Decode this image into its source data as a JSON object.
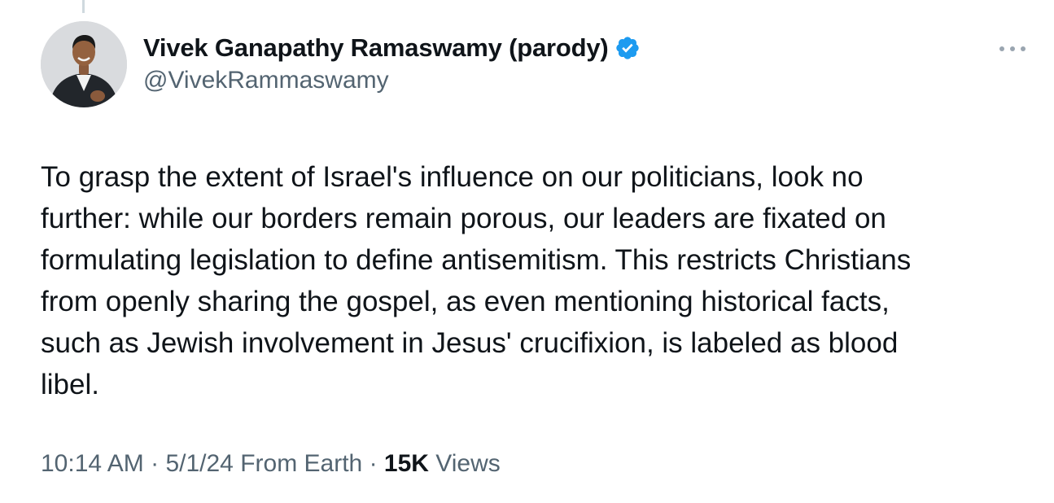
{
  "tweet": {
    "author": {
      "display_name": "Vivek Ganapathy Ramaswamy (parody)",
      "handle": "@VivekRammaswamy",
      "verified": true,
      "verified_color": "#1d9bf0",
      "avatar_icon": "person-photo"
    },
    "more_icon": "more-horizontal-icon",
    "text_lines": [
      "To grasp the extent of Israel's influence on our politicians, look no",
      "further: while our borders remain porous, our leaders are fixated on",
      "formulating legislation to define antisemitism. This restricts Christians",
      "from openly sharing the gospel, as even mentioning historical facts,",
      "such as Jewish involvement in Jesus' crucifixion, is labeled as blood",
      "libel."
    ],
    "meta": {
      "time": "10:14 AM",
      "sep1": " · ",
      "date": "5/1/24",
      "source": " From Earth",
      "sep2": " · ",
      "views_count": "15K",
      "views_label": " Views"
    }
  },
  "colors": {
    "text_primary": "#0f1419",
    "text_secondary": "#536471",
    "thread_line": "#cfd9de"
  }
}
